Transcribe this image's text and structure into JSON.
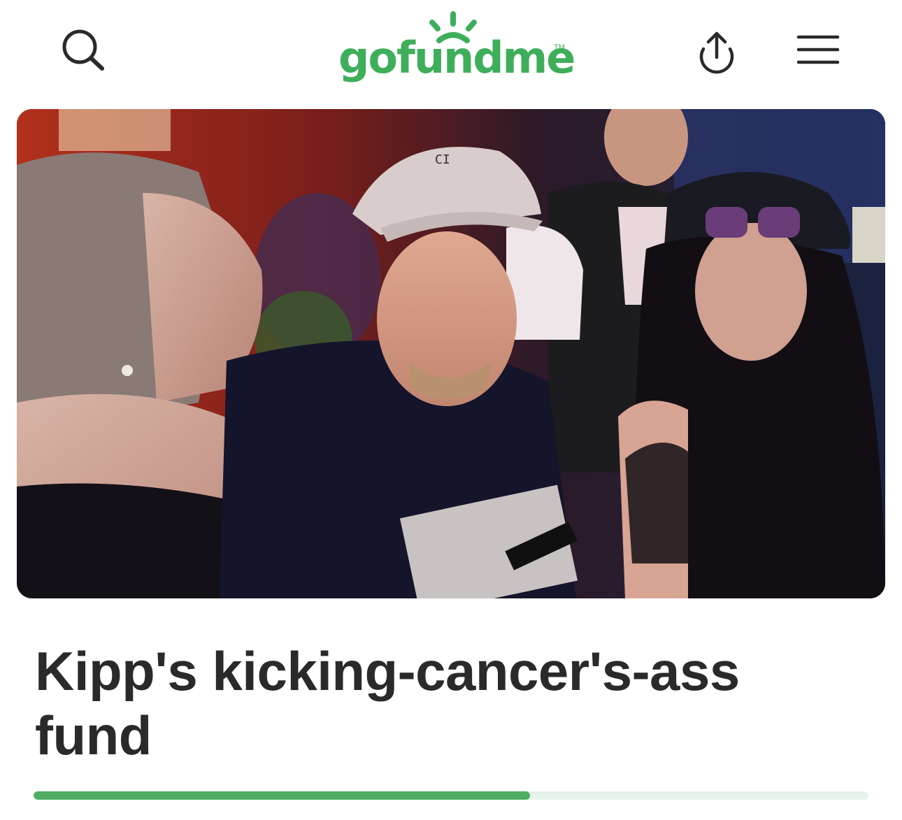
{
  "header": {
    "logo_text": "gofundme",
    "logo_tm": "TM",
    "icons": [
      "search-icon",
      "share-icon",
      "menu-icon"
    ]
  },
  "campaign": {
    "title": "Kipp's kicking-cancer's-ass fund",
    "progress_fraction": 0.595
  },
  "colors": {
    "brand_green": "#3fae5a",
    "progress_fill": "#4fae63",
    "progress_track": "#e6f3ec",
    "title_text": "#2a2a2a"
  }
}
